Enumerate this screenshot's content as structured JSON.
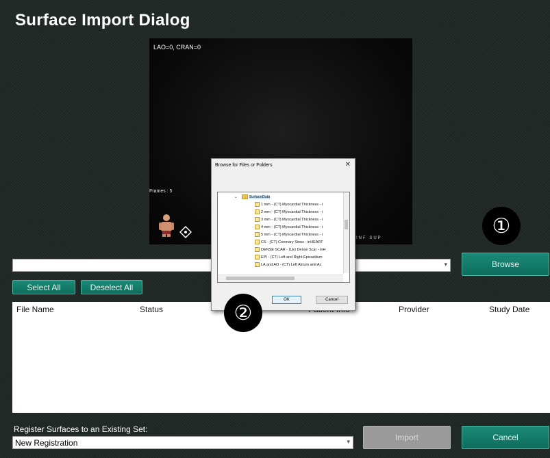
{
  "window": {
    "title": "Surface Import Dialog"
  },
  "viewport": {
    "view_angle": "LAO=0, CRAN=0",
    "frames": "Frames : 5",
    "orientation_labels": "INF SUP"
  },
  "path_combo": {
    "value": ""
  },
  "buttons": {
    "browse": "Browse",
    "select_all": "Select All",
    "deselect_all": "Deselect All",
    "import": "Import",
    "cancel": "Cancel"
  },
  "file_table": {
    "columns": [
      "File Name",
      "Status",
      "",
      "Patient Info",
      "Provider",
      "Study Date"
    ],
    "rows": []
  },
  "registration": {
    "label": "Register Surfaces to an Existing Set:",
    "selected": "New Registration"
  },
  "browse_dialog": {
    "title": "Browse for Files or Folders",
    "close": "✕",
    "folder": "SurfaceData",
    "items": [
      "1 mm - (CT) Myocardial Thickness - i",
      "2 mm - (CT) Myocardial Thickness - i",
      "3 mm - (CT) Myocardial Thickness - i",
      "4 mm - (CT) Myocardial Thickness - i",
      "5 mm - (CT) Myocardial Thickness - i",
      "CS - (CT) Coronary Sinus - inHEART",
      "DENSE SCAR - (LE) Dense Scar - inH",
      "EPI - (CT) Left and Right Epicardium",
      "LA and AO - (CT) Left Atrium and Ac"
    ],
    "ok": "OK",
    "cancel": "Cancel"
  },
  "markers": {
    "one": "①",
    "two": "②"
  },
  "colors": {
    "accent": "#12806d",
    "background": "#222a27"
  }
}
